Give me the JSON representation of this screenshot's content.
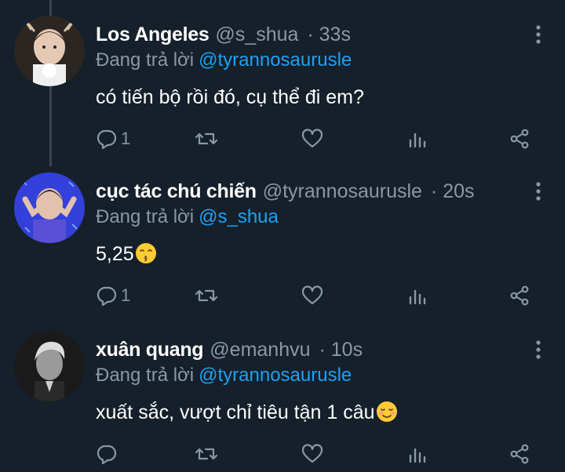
{
  "colors": {
    "background": "#15202b",
    "secondary_text": "#8899a6",
    "accent": "#1da1f2",
    "thread_line": "#38444d"
  },
  "tweets": [
    {
      "display_name": "Los Angeles",
      "handle": "@s_shua",
      "time": "· 33s",
      "replying_label": "Đang trả lời",
      "replying_to": "@tyrannosaurusle",
      "text": "có tiến bộ rồi đó, cụ thể đi em?",
      "emoji_name": "",
      "reply_count": "1"
    },
    {
      "display_name": "cục tác chú chiến",
      "handle": "@tyrannosaurusle",
      "time": "· 20s",
      "replying_label": "Đang trả lời",
      "replying_to": "@s_shua",
      "text": "5,25",
      "emoji_name": "kissing-face-emoji",
      "reply_count": "1"
    },
    {
      "display_name": "xuân quang",
      "handle": "@emanhvu",
      "time": "· 10s",
      "replying_label": "Đang trả lời",
      "replying_to": "@tyrannosaurusle",
      "text": "xuất sắc, vượt chỉ tiêu tận 1 câu",
      "emoji_name": "smiling-face-emoji",
      "reply_count": ""
    }
  ]
}
